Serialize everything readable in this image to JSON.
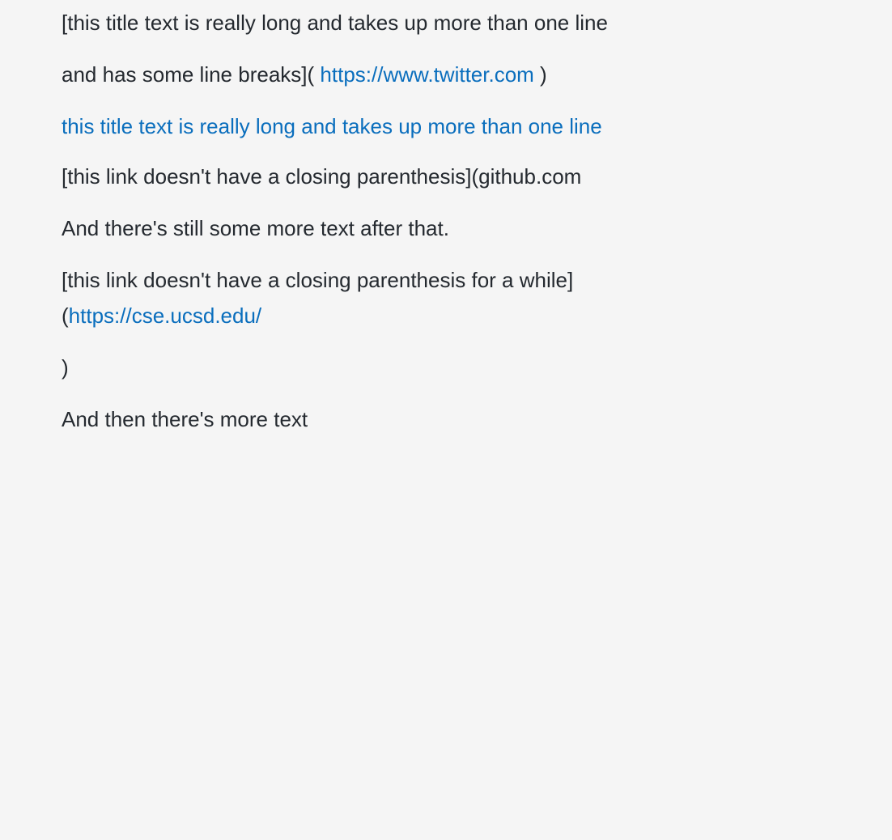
{
  "paragraphs": {
    "p1_line1": "[this title text is really long and takes up more than one line",
    "p1_line2_prefix": "and has some line breaks](",
    "p1_link": "https://www.twitter.com",
    "p1_line2_suffix": ")",
    "p2_link": "this title text is really long and takes up more than one line",
    "p3": "[this link doesn't have a closing parenthesis](github.com",
    "p4": "And there's still some more text after that.",
    "p5_line1": "[this link doesn't have a closing parenthesis for a while]",
    "p5_line2_prefix": "(",
    "p5_link": "https://cse.ucsd.edu/",
    "p6": ")",
    "p7": "And then there's more text"
  },
  "colors": {
    "background": "#f5f5f5",
    "text": "#24292f",
    "link": "#0a6ebd"
  }
}
